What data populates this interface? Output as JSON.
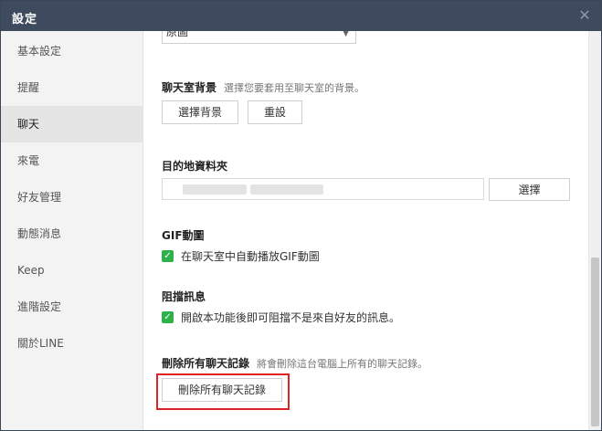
{
  "window": {
    "title": "設定",
    "close_icon": "close-icon"
  },
  "sidebar": {
    "items": [
      {
        "label": "基本設定"
      },
      {
        "label": "提醒"
      },
      {
        "label": "聊天"
      },
      {
        "label": "來電"
      },
      {
        "label": "好友管理"
      },
      {
        "label": "動態消息"
      },
      {
        "label": "Keep"
      },
      {
        "label": "進階設定"
      },
      {
        "label": "關於LINE"
      }
    ],
    "active": "聊天"
  },
  "content": {
    "dropdown": {
      "value": "原圖"
    },
    "background": {
      "title": "聊天室背景",
      "description": "選擇您要套用至聊天室的背景。",
      "select_button": "選擇背景",
      "reset_button": "重設"
    },
    "folder": {
      "title": "目的地資料夾",
      "choose_button": "選擇"
    },
    "gif": {
      "title": "GIF動圖",
      "option": "在聊天室中自動播放GIF動圖"
    },
    "block": {
      "title": "阻擋訊息",
      "option": "開啟本功能後即可阻擋不是來自好友的訊息。"
    },
    "delete": {
      "title": "刪除所有聊天記錄",
      "description": "將會刪除這台電腦上所有的聊天記錄。",
      "button": "刪除所有聊天記錄"
    }
  },
  "colors": {
    "titlebar": "#3e4a5d",
    "check": "#2fb14a",
    "highlight": "#e02424"
  }
}
